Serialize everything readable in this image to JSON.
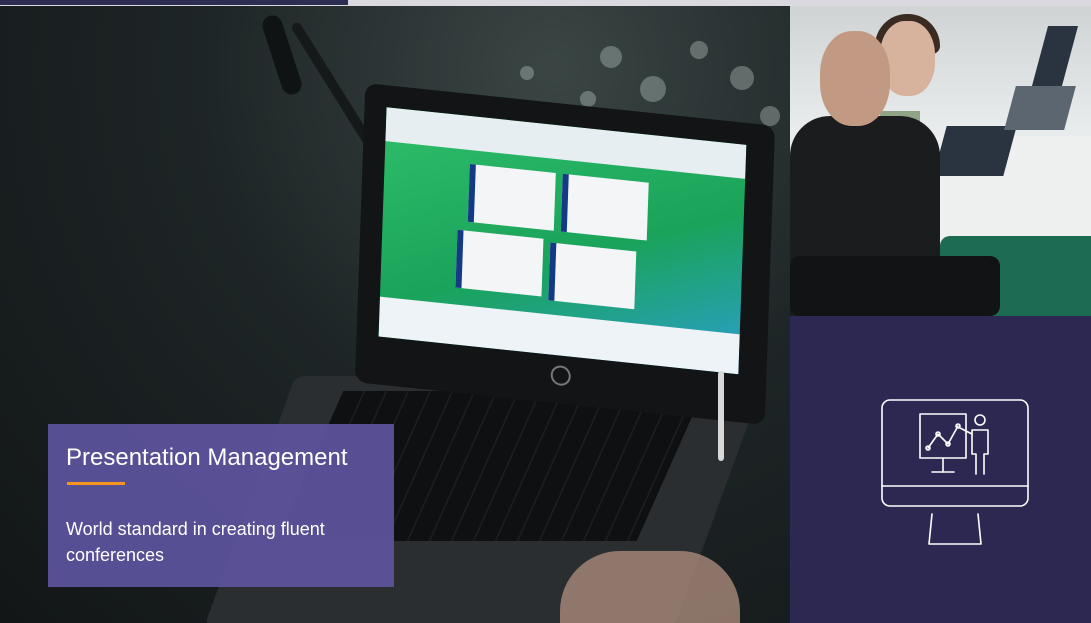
{
  "caption": {
    "title": "Presentation Management",
    "subtitle": "World standard in creating fluent conferences",
    "accent_color": "#f5941e",
    "panel_color": "#5d549e"
  },
  "icon_panel": {
    "icon": "presentation-monitor-icon",
    "background": "#2c2852"
  },
  "images": {
    "hero": "laptop-on-conference-desk-photo",
    "side": "conference-attendees-photo"
  }
}
